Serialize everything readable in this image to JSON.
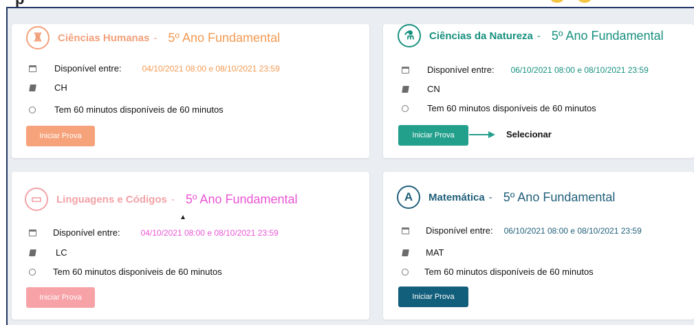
{
  "page": {
    "top_text": "p"
  },
  "cards": [
    {
      "subject": "Ciências Humanas",
      "dash": "-",
      "grade": "5º Ano Fundamental",
      "icon": "trophy-icon",
      "icon_glyph": "♜",
      "available_label": "Disponível entre:",
      "available_value": "04/10/2021 08:00 e 08/10/2021 23:59",
      "code": "CH",
      "time_text": "Tem 60 minutos disponíveis de 60 minutos",
      "button_label": "Iniciar Prova",
      "colors": {
        "subject": "#f2a07b",
        "grade": "#f39a52",
        "date": "#f39a52",
        "button": "#f6a27a"
      }
    },
    {
      "subject": "Ciências da Natureza",
      "dash": "-",
      "grade": "5º Ano Fundamental",
      "icon": "flask-icon",
      "icon_glyph": "⚗",
      "available_label": "Disponível entre:",
      "available_value": "06/10/2021 08:00 e 08/10/2021 23:59",
      "code": "CN",
      "time_text": "Tem 60 minutos disponíveis de 60 minutos",
      "button_label": "Iniciar Prova",
      "colors": {
        "subject": "#17907f",
        "grade": "#17907f",
        "date": "#17907f",
        "button": "#23a08c"
      }
    },
    {
      "subject": "Linguagens e Códigos",
      "dash": "-",
      "grade": "5º Ano Fundamental",
      "icon": "monitor-icon",
      "icon_glyph": "▭",
      "available_label": "Disponível entre:",
      "available_value": "04/10/2021 08:00 e 08/10/2021 23:59",
      "code": "LC",
      "time_text": "Tem 60 minutos disponíveis de 60 minutos",
      "button_label": "Iniciar Prova",
      "colors": {
        "subject": "#f2a2a7",
        "grade": "#ea55d4",
        "date": "#ea55d4",
        "button": "#f6a2a6"
      }
    },
    {
      "subject": "Matemática",
      "dash": "-",
      "grade": "5º Ano Fundamental",
      "icon": "compass-icon",
      "icon_glyph": "A",
      "available_label": "Disponível entre:",
      "available_value": "06/10/2021 08:00 e 08/10/2021 23:59",
      "code": "MAT",
      "time_text": "Tem 60 minutos disponíveis de 60 minutos",
      "button_label": "Iniciar Prova",
      "colors": {
        "subject": "#205f7a",
        "grade": "#205f7a",
        "date": "#205f7a",
        "button": "#125f7c"
      }
    }
  ],
  "annotation": {
    "label": "Selecionar",
    "color": "#23a08c"
  }
}
